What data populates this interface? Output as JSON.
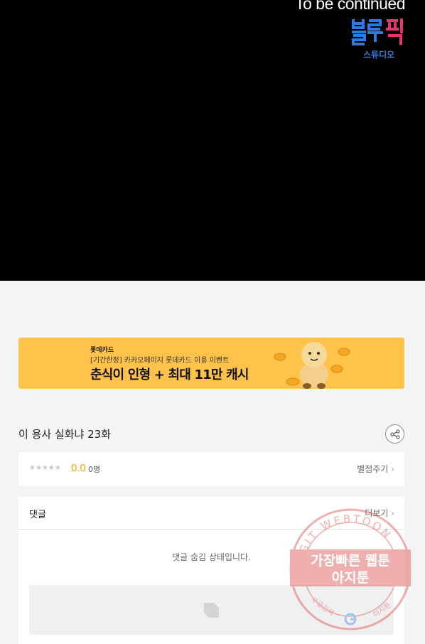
{
  "comic": {
    "end_text": "To be continued",
    "studio_logo_text": [
      "블루픽",
      "스튜디오"
    ]
  },
  "banner": {
    "brand": "롯데카드",
    "sub": "[기간한정] 카카오페이지 롯데카드 이용 이벤트",
    "headline": "춘식이 인형 + 최대 11만 캐시"
  },
  "episode": {
    "title": "이 용사 실화냐 23화",
    "share_icon": "share-icon"
  },
  "rating": {
    "stars_icon": "★★★★★",
    "score": "0.0",
    "count": "0명",
    "rate_link": "별점주기"
  },
  "comments": {
    "title": "댓글",
    "more_link": "더보기",
    "hidden_message": "댓글 숨김 상태입니다."
  },
  "watermark": {
    "arc_text": "AGIT WEBTOON",
    "line1": "가장빠른 웹툰",
    "line2": "아지툰",
    "bottom_left": "구글검색",
    "bottom_right": "아지툰"
  },
  "colors": {
    "banner_bg": "#ffc24a",
    "score": "#f0a300",
    "logo_blue": "#2d7be0",
    "logo_pink": "#e8336e",
    "watermark": "#e05050"
  }
}
